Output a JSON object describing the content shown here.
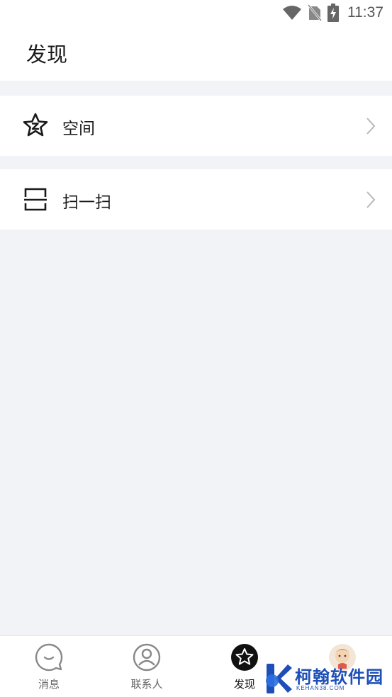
{
  "status_bar": {
    "time": "11:37",
    "icons": [
      "wifi-icon",
      "no-sim-icon",
      "battery-charging-icon"
    ]
  },
  "header": {
    "title": "发现"
  },
  "items": [
    {
      "label": "空间",
      "icon": "qzone-star-icon"
    },
    {
      "label": "扫一扫",
      "icon": "scan-icon"
    }
  ],
  "bottom_nav": [
    {
      "label": "消息",
      "icon": "message-icon",
      "active": false
    },
    {
      "label": "联系人",
      "icon": "contacts-icon",
      "active": false
    },
    {
      "label": "发现",
      "icon": "discover-star-icon",
      "active": true
    },
    {
      "label": "",
      "icon": "avatar",
      "active": false
    }
  ],
  "watermark": {
    "text": "柯翰软件园",
    "sub": "KEHAN38.COM"
  },
  "colors": {
    "background": "#f2f3f7",
    "card": "#ffffff",
    "watermark": "#1e4fb8"
  }
}
